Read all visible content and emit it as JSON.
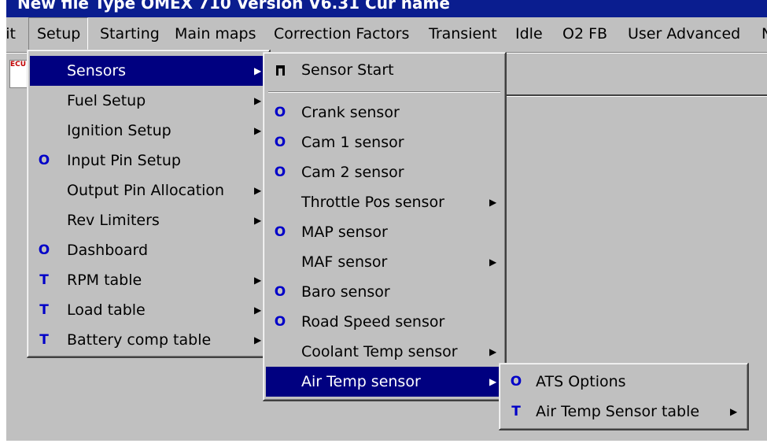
{
  "window": {
    "title": "New file   Type  OMEX 710  Version  V6.31  Cur name"
  },
  "menubar": {
    "items": [
      {
        "label": "lit"
      },
      {
        "label": "Setup"
      },
      {
        "label": "Starting"
      },
      {
        "label": "Main maps"
      },
      {
        "label": "Correction Factors"
      },
      {
        "label": "Transient"
      },
      {
        "label": "Idle"
      },
      {
        "label": "O2 FB"
      },
      {
        "label": "User Advanced"
      },
      {
        "label": "N"
      }
    ]
  },
  "toolbar": {
    "icon_text": "ECU",
    "icon": "document-icon"
  },
  "setup_menu": {
    "items": [
      {
        "label": "Sensors",
        "icon": "",
        "submenu": true
      },
      {
        "label": "Fuel Setup",
        "icon": "",
        "submenu": true
      },
      {
        "label": "Ignition Setup",
        "icon": "",
        "submenu": true
      },
      {
        "label": "Input Pin Setup",
        "icon": "O",
        "submenu": false
      },
      {
        "label": "Output Pin Allocation",
        "icon": "",
        "submenu": true
      },
      {
        "label": "Rev Limiters",
        "icon": "",
        "submenu": true
      },
      {
        "label": "Dashboard",
        "icon": "O",
        "submenu": false
      },
      {
        "label": "RPM table",
        "icon": "T",
        "submenu": true
      },
      {
        "label": "Load table",
        "icon": "T",
        "submenu": true
      },
      {
        "label": "Battery comp table",
        "icon": "T",
        "submenu": true
      }
    ]
  },
  "sensors_menu": {
    "items": [
      {
        "label": "Sensor Start",
        "icon": "T",
        "submenu": false
      },
      {
        "label": "Crank sensor",
        "icon": "O",
        "submenu": false
      },
      {
        "label": "Cam 1 sensor",
        "icon": "O",
        "submenu": false
      },
      {
        "label": "Cam 2 sensor",
        "icon": "O",
        "submenu": false
      },
      {
        "label": "Throttle Pos sensor",
        "icon": "",
        "submenu": true
      },
      {
        "label": "MAP sensor",
        "icon": "O",
        "submenu": false
      },
      {
        "label": "MAF sensor",
        "icon": "",
        "submenu": true
      },
      {
        "label": "Baro sensor",
        "icon": "O",
        "submenu": false
      },
      {
        "label": "Road Speed sensor",
        "icon": "O",
        "submenu": false
      },
      {
        "label": "Coolant Temp sensor",
        "icon": "",
        "submenu": true
      },
      {
        "label": "Air Temp sensor",
        "icon": "",
        "submenu": true
      }
    ]
  },
  "air_temp_menu": {
    "items": [
      {
        "label": "ATS Options",
        "icon": "O",
        "submenu": false
      },
      {
        "label": "Air Temp Sensor table",
        "icon": "T",
        "submenu": true
      }
    ]
  },
  "glyphs": {
    "arrow": "▶"
  }
}
